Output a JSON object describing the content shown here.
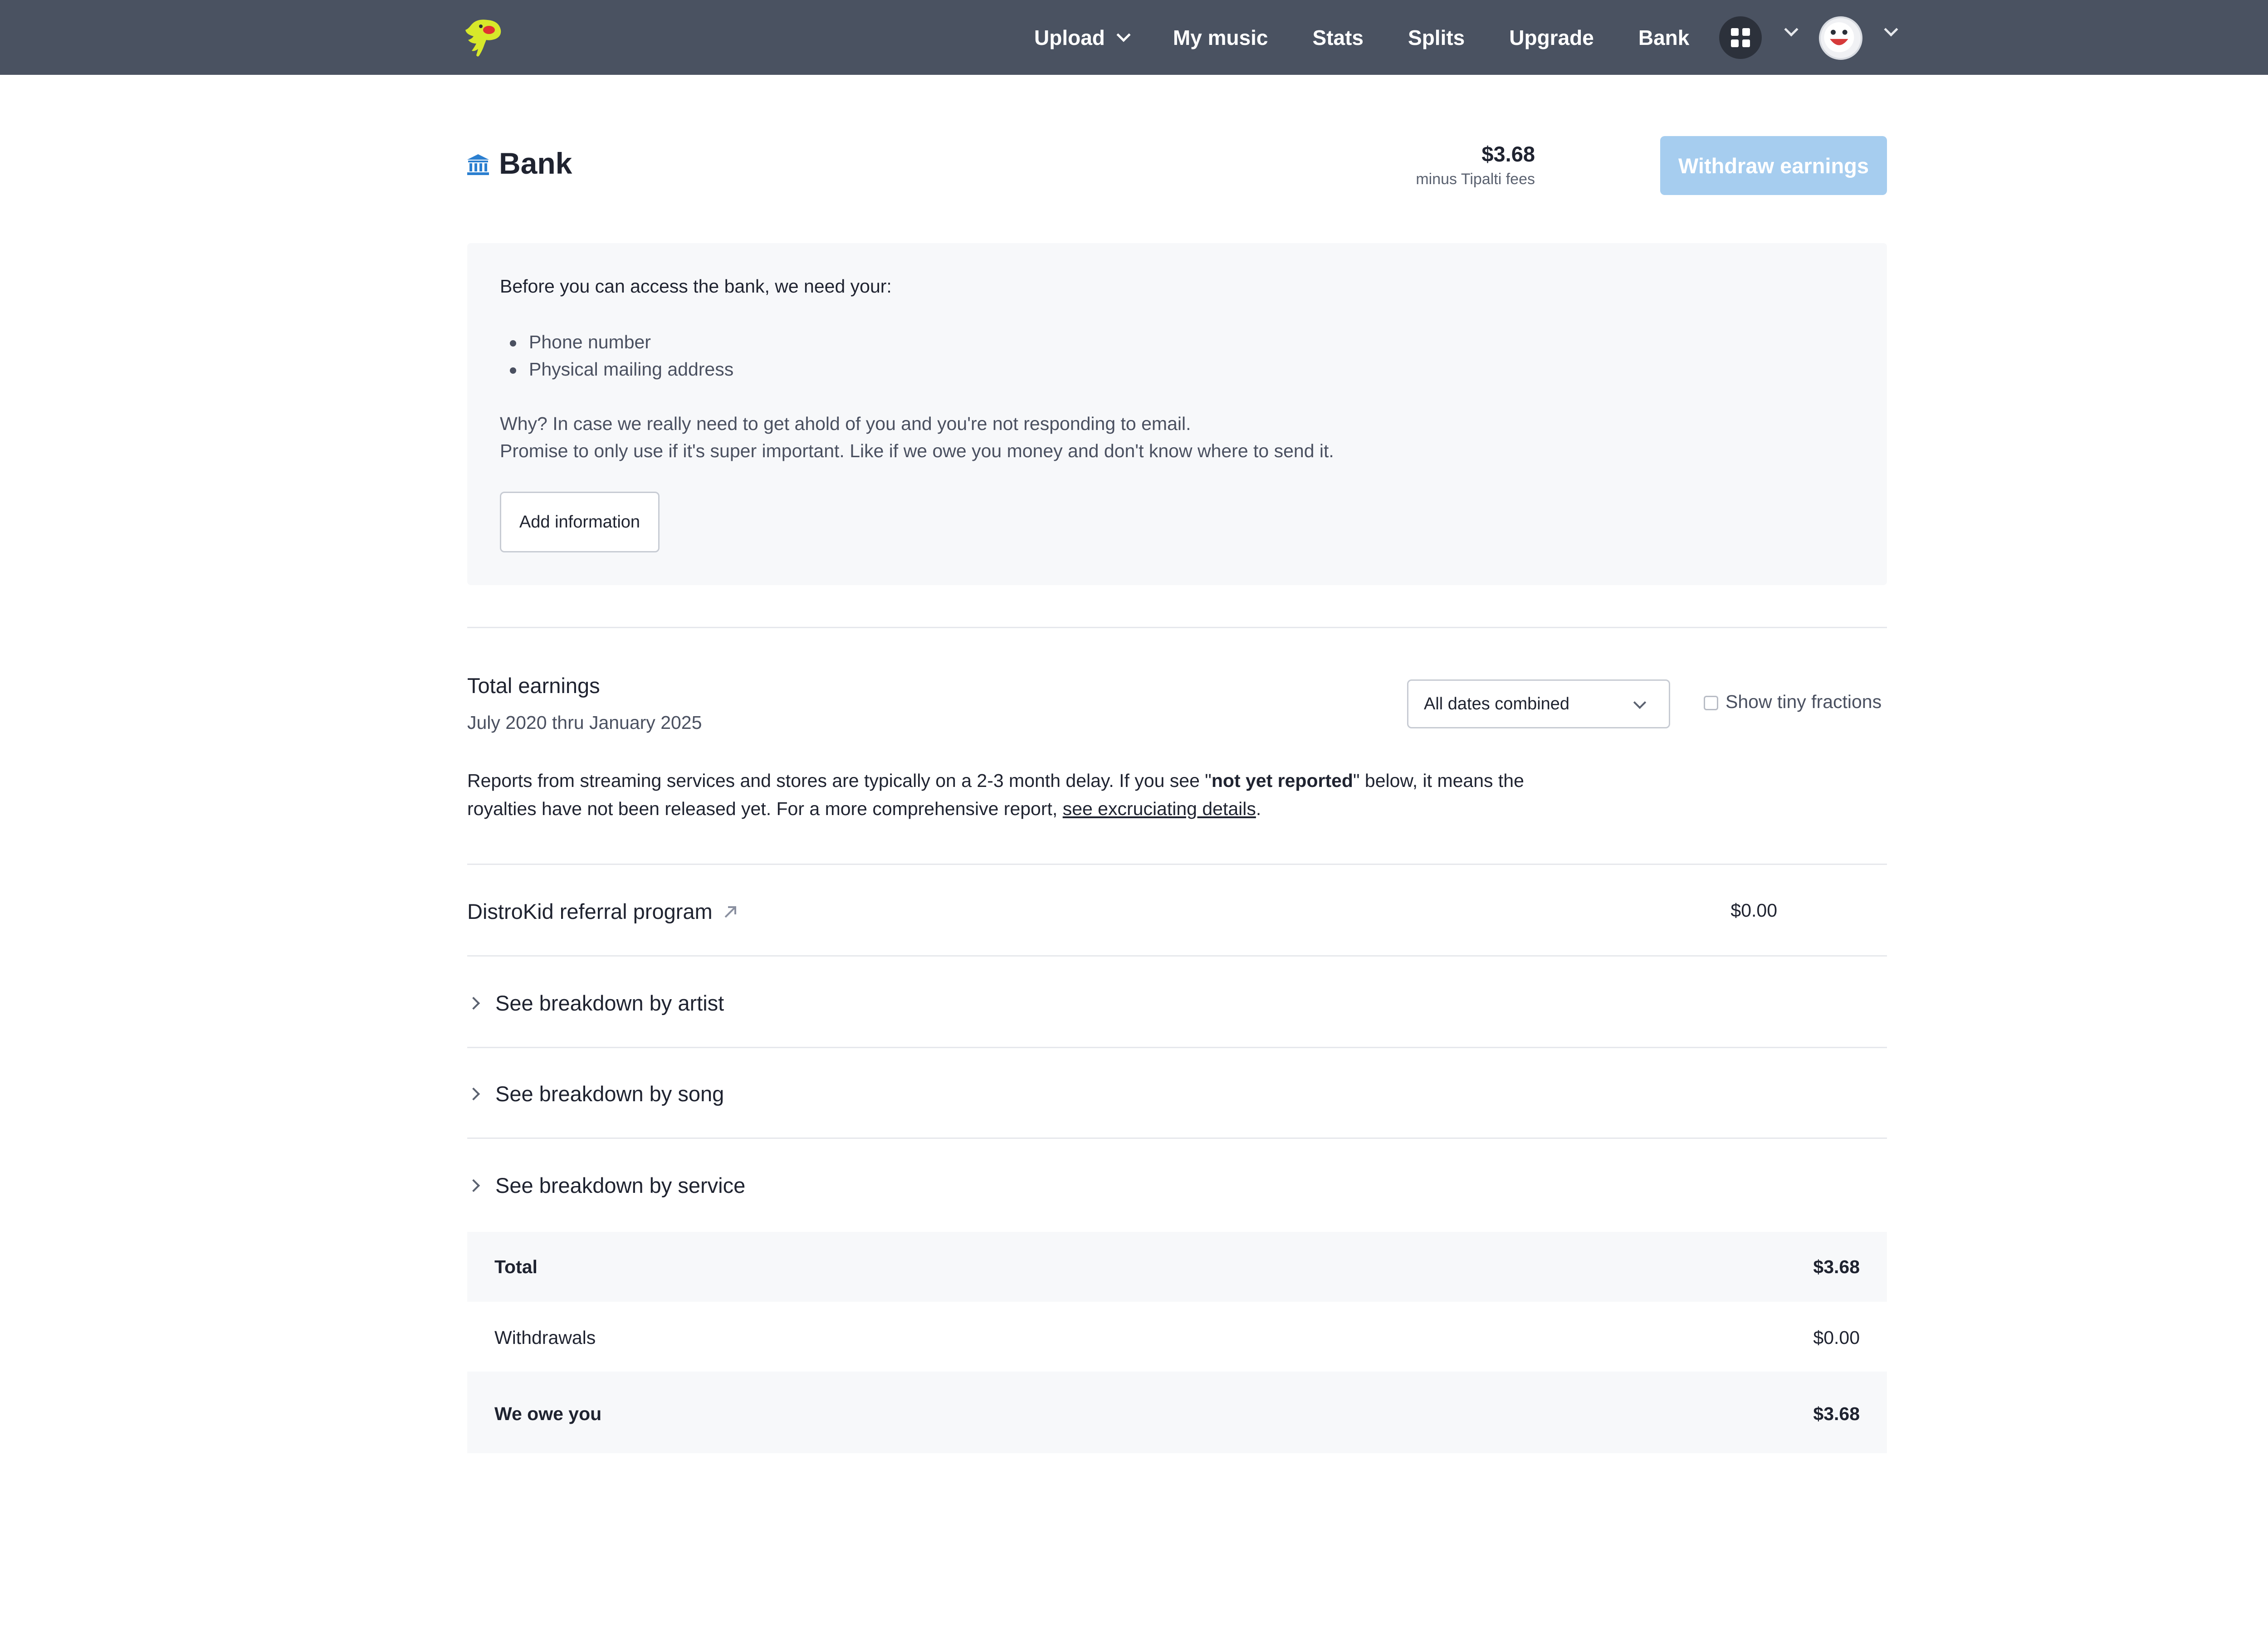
{
  "nav": {
    "items": [
      {
        "label": "Upload",
        "has_dropdown": true
      },
      {
        "label": "My music"
      },
      {
        "label": "Stats"
      },
      {
        "label": "Splits"
      },
      {
        "label": "Upgrade"
      },
      {
        "label": "Bank"
      }
    ],
    "apps_icon": "apps-grid-icon",
    "avatar_icon": "avatar"
  },
  "header": {
    "title": "Bank",
    "icon": "bank-icon",
    "balance": "$3.68",
    "balance_note": "minus Tipalti fees",
    "withdraw_label": "Withdraw earnings"
  },
  "info": {
    "intro": "Before you can access the bank, we need your:",
    "items": [
      "Phone number",
      "Physical mailing address"
    ],
    "why_line1": "Why? In case we really need to get ahold of you and you're not responding to email.",
    "why_line2": "Promise to only use if it's super important. Like if we owe you money and don't know where to send it.",
    "button_label": "Add information"
  },
  "earnings": {
    "title": "Total earnings",
    "range": "July 2020 thru January 2025",
    "dates_select": "All dates combined",
    "fractions_label": "Show tiny fractions",
    "note_part1": "Reports from streaming services and stores are typically on a 2-3 month delay. If you see \"",
    "note_bold": "not yet reported",
    "note_part2": "\" below, it means the royalties have not been released yet. For a more comprehensive report, ",
    "note_link": "see excruciating details",
    "note_end": ".",
    "referral_label": "DistroKid referral program",
    "referral_value": "$0.00",
    "breakdowns": [
      "See breakdown by artist",
      "See breakdown by song",
      "See breakdown by service"
    ]
  },
  "summary": {
    "total_label": "Total",
    "total_value": "$3.68",
    "withdrawals_label": "Withdrawals",
    "withdrawals_value": "$0.00",
    "owe_label": "We owe you",
    "owe_value": "$3.68"
  },
  "colors": {
    "nav_bg": "#4a5261",
    "withdraw_btn": "#a6cdef",
    "bank_icon": "#2b7fd0",
    "logo": "#d7e82a"
  }
}
